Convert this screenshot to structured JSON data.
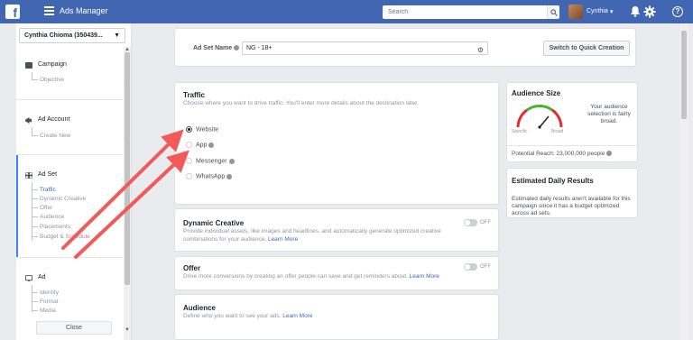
{
  "topbar": {
    "logo": "f",
    "title": "Ads Manager",
    "search_placeholder": "Search",
    "user_name": "Cynthia",
    "help": "?"
  },
  "sidebar": {
    "account": "Cynthia Chioma (350439...",
    "campaign": {
      "label": "Campaign",
      "items": [
        "Objective"
      ]
    },
    "ad_account": {
      "label": "Ad Account",
      "items": [
        "Create New"
      ]
    },
    "ad_set": {
      "label": "Ad Set",
      "items": [
        "Traffic",
        "Dynamic Creative",
        "Offer",
        "Audience",
        "Placements",
        "Budget & Schedule"
      ]
    },
    "ad": {
      "label": "Ad",
      "items": [
        "Identity",
        "Format",
        "Media"
      ]
    },
    "close": "Close"
  },
  "adset_name": {
    "label": "Ad Set Name",
    "value": "NG - 18+",
    "switch_button": "Switch to Quick Creation"
  },
  "traffic": {
    "title": "Traffic",
    "description": "Choose where you want to drive traffic. You'll enter more details about the destination later.",
    "options": [
      "Website",
      "App",
      "Messenger",
      "WhatsApp"
    ],
    "selected": "Website"
  },
  "dynamic_creative": {
    "title": "Dynamic Creative",
    "description": "Provide individual assets, like images and headlines, and automatically generate optimized creative",
    "description2": "combinations for your audience.",
    "learn_more": "Learn More",
    "toggle": "OFF"
  },
  "offer": {
    "title": "Offer",
    "description": "Drive more conversions by creating an offer people can save and get reminders about.",
    "learn_more": "Learn More",
    "toggle": "OFF"
  },
  "audience": {
    "title": "Audience",
    "description": "Define who you want to see your ads.",
    "learn_more": "Learn More"
  },
  "audience_size": {
    "title": "Audience Size",
    "text": "Your audience selection is fairly broad.",
    "specific": "Specific",
    "broad": "Broad",
    "reach": "Potential Reach: 23,000,000 people"
  },
  "estimated": {
    "title": "Estimated Daily Results",
    "text": "Estimated daily results aren't available for this campaign since it has a budget optimized across ad sets."
  },
  "colors": {
    "brand": "#4267b2",
    "arrow": "#f25a5a",
    "active": "#4080ff"
  }
}
